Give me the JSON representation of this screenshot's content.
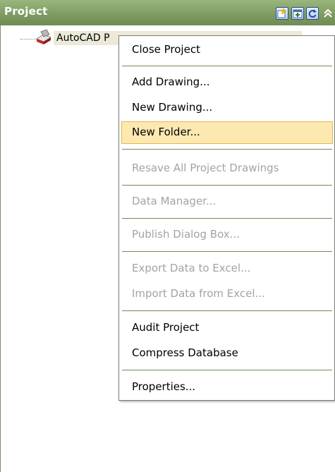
{
  "panel": {
    "title": "Project",
    "toolbar": [
      {
        "icon": "new-project-icon"
      },
      {
        "icon": "add-drawing-icon"
      },
      {
        "icon": "refresh-icon"
      }
    ],
    "collapse_icon": "chevron-up-icon"
  },
  "tree": {
    "root_label": "AutoCAD P",
    "root_icon": "autocad-project-icon"
  },
  "menu": {
    "items": [
      {
        "label": "Close Project",
        "enabled": true
      },
      {
        "label": "Add Drawing...",
        "enabled": true
      },
      {
        "label": "New Drawing...",
        "enabled": true
      },
      {
        "label": "New Folder...",
        "enabled": true,
        "highlighted": true
      },
      {
        "label": "Resave All Project Drawings",
        "enabled": false
      },
      {
        "label": "Data Manager...",
        "enabled": false
      },
      {
        "label": "Publish Dialog Box...",
        "enabled": false
      },
      {
        "label": "Export Data to Excel...",
        "enabled": false
      },
      {
        "label": "Import Data from Excel...",
        "enabled": false
      },
      {
        "label": "Audit Project",
        "enabled": true
      },
      {
        "label": "Compress Database",
        "enabled": true
      },
      {
        "label": "Properties...",
        "enabled": true
      }
    ]
  },
  "colors": {
    "header": "#7d9a60",
    "highlight": "#fde8b0",
    "disabled_text": "#a3a3a3"
  }
}
